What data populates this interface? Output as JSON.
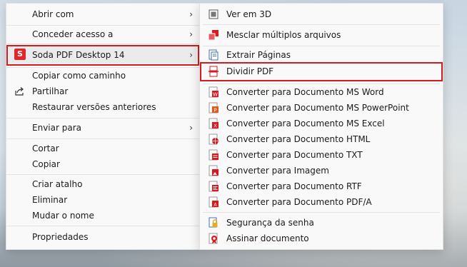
{
  "main_menu": {
    "items": [
      {
        "label": "Abrir com"
      },
      {
        "label": "Conceder acesso a"
      },
      {
        "label": "Soda PDF Desktop 14",
        "badge": "S"
      },
      {
        "label": "Copiar como caminho"
      },
      {
        "label": "Partilhar"
      },
      {
        "label": "Restaurar versões anteriores"
      },
      {
        "label": "Enviar para"
      },
      {
        "label": "Cortar"
      },
      {
        "label": "Copiar"
      },
      {
        "label": "Criar atalho"
      },
      {
        "label": "Eliminar"
      },
      {
        "label": "Mudar o nome"
      },
      {
        "label": "Propriedades"
      }
    ],
    "chevron": "›"
  },
  "sub_menu": {
    "items": [
      {
        "label": "Ver em 3D",
        "icon": "cube-3d-icon"
      },
      {
        "label": "Mesclar múltiplos arquivos",
        "icon": "merge-pdf-icon"
      },
      {
        "label": "Extrair Páginas",
        "icon": "extract-pages-icon"
      },
      {
        "label": "Dividir PDF",
        "icon": "split-pdf-icon"
      },
      {
        "label": "Converter para Documento MS Word",
        "icon": "word-document-icon"
      },
      {
        "label": "Converter para Documento MS PowerPoint",
        "icon": "powerpoint-document-icon"
      },
      {
        "label": "Converter para Documento MS Excel",
        "icon": "excel-document-icon"
      },
      {
        "label": "Converter para Documento HTML",
        "icon": "html-document-icon"
      },
      {
        "label": "Converter para Documento TXT",
        "icon": "txt-document-icon"
      },
      {
        "label": "Converter para Imagem",
        "icon": "image-document-icon"
      },
      {
        "label": "Converter para Documento RTF",
        "icon": "rtf-document-icon"
      },
      {
        "label": "Converter para Documento PDF/A",
        "icon": "pdfa-document-icon"
      },
      {
        "label": "Segurança da senha",
        "icon": "password-lock-icon"
      },
      {
        "label": "Assinar documento",
        "icon": "sign-document-icon"
      }
    ]
  },
  "colors": {
    "accent_red": "#d71920",
    "soda_red": "#e0262b"
  }
}
